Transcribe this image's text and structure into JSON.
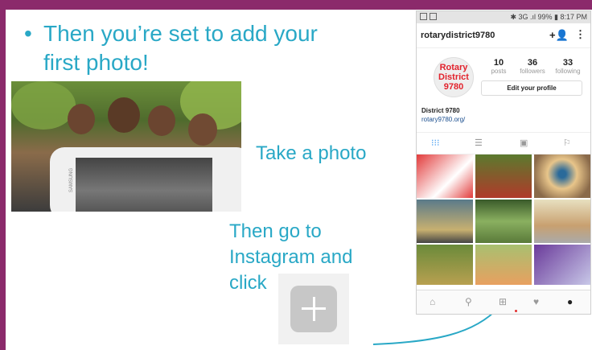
{
  "slide": {
    "bullet": "•",
    "heading": "Then you’re set to add your first photo!",
    "take_photo": "Take a photo",
    "then_go": "Then go to Instagram and click",
    "phone_brand": "SAMSUNG"
  },
  "phone": {
    "status": {
      "text": "✱ 3G .ıl 99% ▮ 8:17 PM"
    },
    "username": "rotarydistrict9780",
    "add_user_icon": "+👤",
    "menu_icon": "⋮",
    "avatar_text": "Rotary District 9780",
    "stats": [
      {
        "num": "10",
        "label": "posts"
      },
      {
        "num": "36",
        "label": "followers"
      },
      {
        "num": "33",
        "label": "following"
      }
    ],
    "edit_profile": "Edit your profile",
    "bio_name": "District 9780",
    "bio_link": "rotary9780.org/",
    "tabs": [
      "grid-icon",
      "list-icon",
      "tagged-icon",
      "bookmark-icon"
    ],
    "nav": [
      "home-icon",
      "search-icon",
      "add-icon",
      "heart-icon",
      "profile-icon"
    ]
  },
  "colors": {
    "frame": "#8b2a6b",
    "text_accent": "#29a8c6",
    "rotary_red": "#e2222c"
  }
}
